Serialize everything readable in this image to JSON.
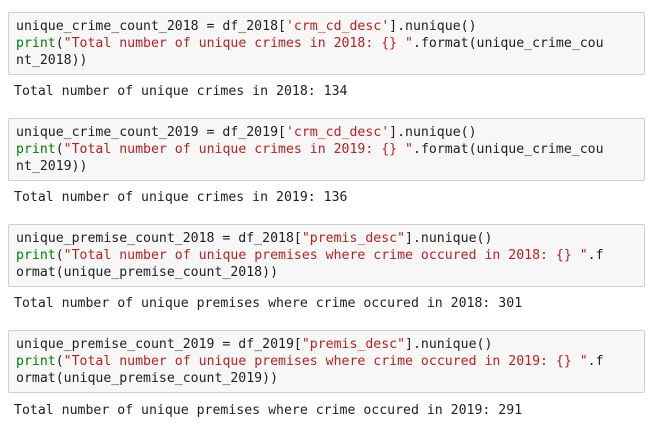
{
  "cells": [
    {
      "code_lines": [
        [
          {
            "t": "unique_crime_count_2018 = df_2018[",
            "c": "plain"
          },
          {
            "t": "'crm_cd_desc'",
            "c": "str"
          },
          {
            "t": "].nunique()",
            "c": "plain"
          }
        ],
        [
          {
            "t": "print",
            "c": "kw"
          },
          {
            "t": "(",
            "c": "plain"
          },
          {
            "t": "\"Total number of unique crimes in 2018: {} \"",
            "c": "str"
          },
          {
            "t": ".format(unique_crime_cou",
            "c": "plain"
          }
        ],
        [
          {
            "t": "nt_2018))",
            "c": "plain"
          }
        ]
      ],
      "output": "Total number of unique crimes in 2018: 134"
    },
    {
      "code_lines": [
        [
          {
            "t": "unique_crime_count_2019 = df_2019[",
            "c": "plain"
          },
          {
            "t": "'crm_cd_desc'",
            "c": "str"
          },
          {
            "t": "].nunique()",
            "c": "plain"
          }
        ],
        [
          {
            "t": "print",
            "c": "kw"
          },
          {
            "t": "(",
            "c": "plain"
          },
          {
            "t": "\"Total number of unique crimes in 2019: {} \"",
            "c": "str"
          },
          {
            "t": ".format(unique_crime_cou",
            "c": "plain"
          }
        ],
        [
          {
            "t": "nt_2019))",
            "c": "plain"
          }
        ]
      ],
      "output": "Total number of unique crimes in 2019: 136"
    },
    {
      "code_lines": [
        [
          {
            "t": "unique_premise_count_2018 = df_2018[",
            "c": "plain"
          },
          {
            "t": "\"premis_desc\"",
            "c": "str"
          },
          {
            "t": "].nunique()",
            "c": "plain"
          }
        ],
        [
          {
            "t": "print",
            "c": "kw"
          },
          {
            "t": "(",
            "c": "plain"
          },
          {
            "t": "\"Total number of unique premises where crime occured in 2018: {} \"",
            "c": "str"
          },
          {
            "t": ".f",
            "c": "plain"
          }
        ],
        [
          {
            "t": "ormat(unique_premise_count_2018))",
            "c": "plain"
          }
        ]
      ],
      "output": "Total number of unique premises where crime occured in 2018: 301"
    },
    {
      "code_lines": [
        [
          {
            "t": "unique_premise_count_2019 = df_2019[",
            "c": "plain"
          },
          {
            "t": "\"premis_desc\"",
            "c": "str"
          },
          {
            "t": "].nunique()",
            "c": "plain"
          }
        ],
        [
          {
            "t": "print",
            "c": "kw"
          },
          {
            "t": "(",
            "c": "plain"
          },
          {
            "t": "\"Total number of unique premises where crime occured in 2019: {} \"",
            "c": "str"
          },
          {
            "t": ".f",
            "c": "plain"
          }
        ],
        [
          {
            "t": "ormat(unique_premise_count_2019))",
            "c": "plain"
          }
        ]
      ],
      "output": "Total number of unique premises where crime occured in 2019: 291"
    }
  ]
}
